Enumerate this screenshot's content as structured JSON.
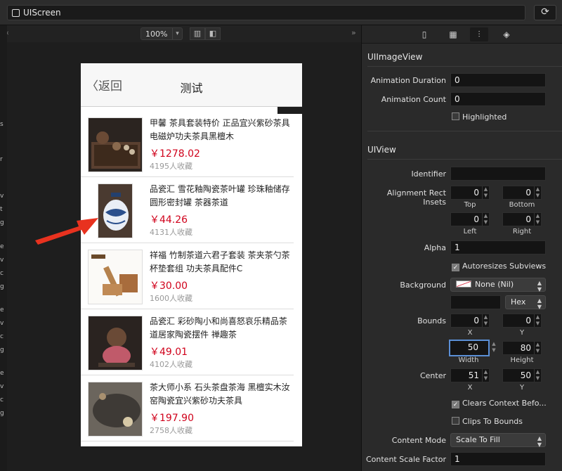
{
  "topbar": {
    "window_title": "UIScreen"
  },
  "canvas_toolbar": {
    "zoom": "100%"
  },
  "gutter": {
    "letters": [
      "s",
      "r",
      "v",
      "t",
      "g",
      "e",
      "v",
      "c",
      "g",
      "e",
      "v",
      "c",
      "g",
      "e",
      "v",
      "c",
      "g"
    ]
  },
  "phone": {
    "back_label": "返回",
    "nav_title": "测试",
    "items": [
      {
        "title": "甲馨 茶具套装特价 正品宜兴紫砂茶具 电磁炉功夫茶具黑檀木",
        "price": "￥1278.02",
        "fav": "4195人收藏"
      },
      {
        "title": "品瓷汇 雪花釉陶瓷茶叶罐 珍珠釉储存圆形密封罐 茶器茶道",
        "price": "￥44.26",
        "fav": "4131人收藏"
      },
      {
        "title": "祥福 竹制茶道六君子套装 茶夹茶勺茶杯垫套组 功夫茶具配件C",
        "price": "￥30.00",
        "fav": "1600人收藏"
      },
      {
        "title": "品瓷汇 彩砂陶小和尚喜怒哀乐精品茶道居家陶瓷摆件 禅趣茶",
        "price": "￥49.01",
        "fav": "4102人收藏"
      },
      {
        "title": "茶大师小系 石头茶盘茶海 黑檀实木汝窑陶瓷宜兴紫砂功夫茶具",
        "price": "￥197.90",
        "fav": "2758人收藏"
      }
    ]
  },
  "inspector": {
    "imageview": {
      "header": "UIImageView",
      "animation_duration_label": "Animation Duration",
      "animation_duration": "0",
      "animation_count_label": "Animation Count",
      "animation_count": "0",
      "highlighted_label": "Highlighted"
    },
    "view": {
      "header": "UIView",
      "identifier_label": "Identifier",
      "identifier": "",
      "insets_label": "Alignment Rect Insets",
      "insets": {
        "top": "0",
        "bottom": "0",
        "left": "0",
        "right": "0"
      },
      "top_label": "Top",
      "bottom_label": "Bottom",
      "left_label": "Left",
      "right_label": "Right",
      "alpha_label": "Alpha",
      "alpha": "1",
      "autoresizes_label": "Autoresizes Subviews",
      "background_label": "Background",
      "background_value": "None (Nil)",
      "hex_label": "Hex",
      "bounds_label": "Bounds",
      "bounds": {
        "x": "0",
        "y": "0",
        "width": "50",
        "height": "80"
      },
      "x_label": "X",
      "y_label": "Y",
      "width_label": "Width",
      "height_label": "Height",
      "center_label": "Center",
      "center": {
        "x": "51",
        "y": "50"
      },
      "clears_label": "Clears Context Befo...",
      "clips_label": "Clips To Bounds",
      "content_mode_label": "Content Mode",
      "content_mode": "Scale To Fill",
      "scale_factor_label": "Content Scale Factor",
      "scale_factor": "1"
    }
  },
  "colors": {
    "price_red": "#d0021b",
    "arrow_red": "#e8321f",
    "focus_blue": "#5b8fd6"
  }
}
